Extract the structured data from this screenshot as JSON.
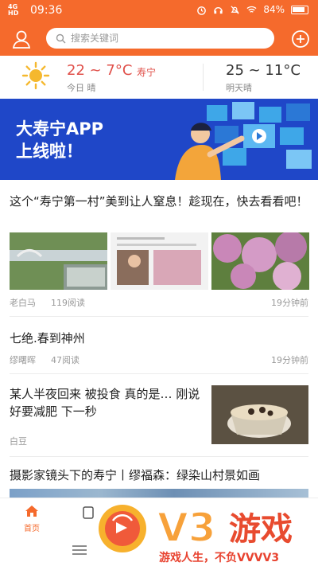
{
  "status": {
    "network": "4G HD",
    "time": "09:36",
    "battery": "84%"
  },
  "header": {
    "search_placeholder": "搜索关键词"
  },
  "weather": {
    "today_temp": "22 ~ 7°C",
    "city": "寿宁",
    "today_label": "今日 晴",
    "tomorrow_temp": "25 ~ 11°C",
    "tomorrow_label": "明天晴"
  },
  "banner": {
    "line1": "大寿宁APP",
    "line2": "上线啦！"
  },
  "articles": [
    {
      "title": "这个“寿宁第一村”美到让人窒息！趁现在，快去看看吧！",
      "source": "老白马",
      "reads": "119阅读",
      "time": "19分钟前"
    },
    {
      "title": "七绝.春到神州",
      "source": "缪曙晖",
      "reads": "47阅读",
      "time": "19分钟前"
    },
    {
      "title": "某人半夜回来 被投食 真的是… 刚说好要减肥 下一秒",
      "source": "白豆"
    },
    {
      "title": "摄影家镜头下的寿宁丨缪福森：绿染山村景如画"
    }
  ],
  "tabbar": {
    "home_label": "首页"
  },
  "watermark": {
    "brand": "V3游戏",
    "slogan": "游戏人生，不负VVVV3"
  },
  "colors": {
    "accent": "#f56a2c",
    "weather_red": "#e0504a",
    "banner_blue": "#1f47c8"
  }
}
